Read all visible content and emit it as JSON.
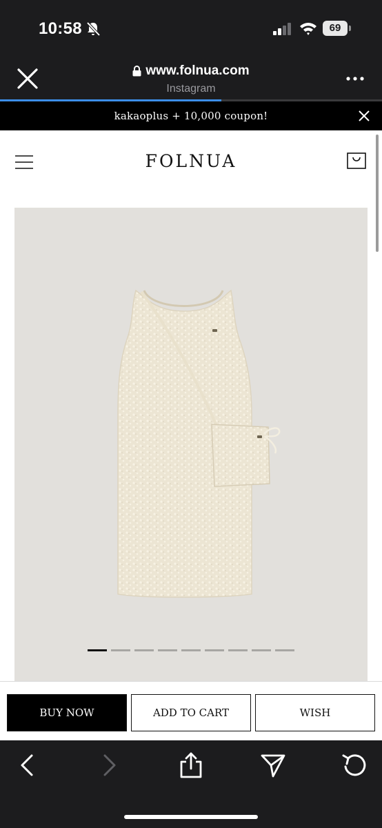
{
  "status_bar": {
    "time": "10:58",
    "battery": "69",
    "icons": [
      "bell-slash-icon",
      "signal-icon",
      "wifi-icon",
      "battery-icon"
    ]
  },
  "browser": {
    "url": "www.folnua.com",
    "source": "Instagram",
    "load_progress": 0.58,
    "accent_color": "#3c8ee8"
  },
  "promo": {
    "text": "kakaoplus + 10,000 coupon!"
  },
  "site": {
    "brand": "FOLNUA",
    "image_index_active": 1,
    "image_count": 9
  },
  "actions": {
    "buy_now": "BUY NOW",
    "add_to_cart": "ADD TO CART",
    "wish": "WISH"
  },
  "toolbar": {
    "icons": [
      "back-icon",
      "forward-icon",
      "share-icon",
      "send-icon",
      "reload-icon"
    ]
  }
}
